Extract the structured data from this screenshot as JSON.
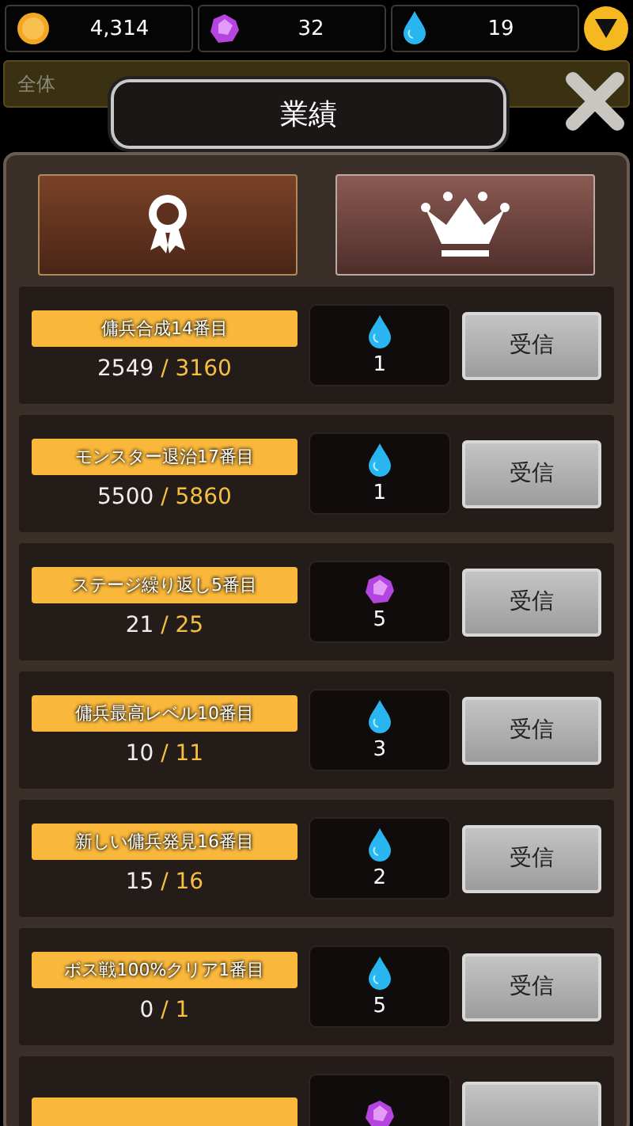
{
  "currencies": [
    {
      "kind": "gold",
      "amount": "4,314"
    },
    {
      "kind": "gem",
      "amount": "32"
    },
    {
      "kind": "drop",
      "amount": "19"
    }
  ],
  "background": {
    "label": "全体"
  },
  "dialog": {
    "title": "業績",
    "tabs": [
      {
        "kind": "ribbon",
        "selected": true
      },
      {
        "kind": "crown",
        "selected": false
      }
    ],
    "achievements": [
      {
        "name": "傭兵合成14番目",
        "current": "2549",
        "target": "/ 3160",
        "reward": {
          "kind": "drop",
          "amount": "1"
        },
        "button": "受信"
      },
      {
        "name": "モンスター退治17番目",
        "current": "5500",
        "target": "/ 5860",
        "reward": {
          "kind": "drop",
          "amount": "1"
        },
        "button": "受信"
      },
      {
        "name": "ステージ繰り返し5番目",
        "current": "21",
        "target": "/ 25",
        "reward": {
          "kind": "gem",
          "amount": "5"
        },
        "button": "受信"
      },
      {
        "name": "傭兵最高レベル10番目",
        "current": "10",
        "target": "/ 11",
        "reward": {
          "kind": "drop",
          "amount": "3"
        },
        "button": "受信"
      },
      {
        "name": "新しい傭兵発見16番目",
        "current": "15",
        "target": "/ 16",
        "reward": {
          "kind": "drop",
          "amount": "2"
        },
        "button": "受信"
      },
      {
        "name": "ボス戦100%クリア1番目",
        "current": "0",
        "target": "/ 1",
        "reward": {
          "kind": "drop",
          "amount": "5"
        },
        "button": "受信"
      },
      {
        "reward": {
          "kind": "gem"
        }
      }
    ]
  }
}
